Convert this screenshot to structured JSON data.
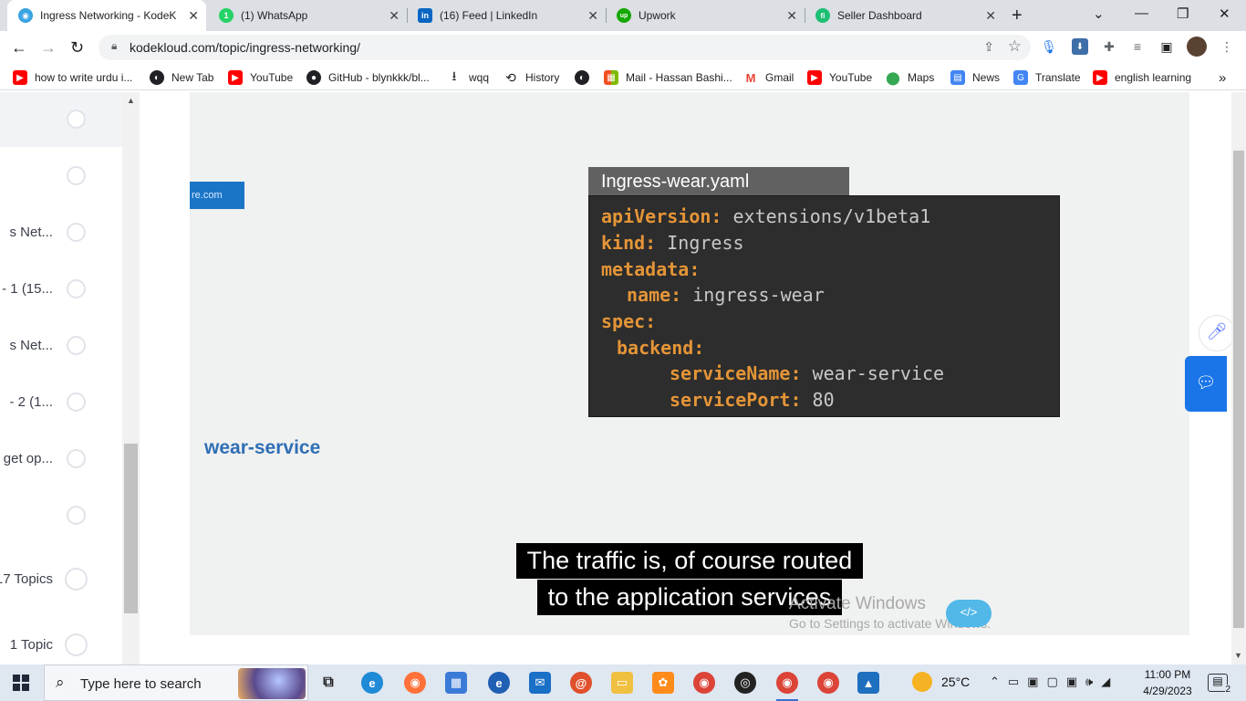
{
  "browser": {
    "tabs": [
      {
        "title": "Ingress Networking - KodeKl",
        "favicon_color": "#3aa3e3",
        "favicon_glyph": "◉",
        "active": true
      },
      {
        "title": "(1) WhatsApp",
        "favicon_color": "#25d366",
        "favicon_glyph": "1",
        "active": false
      },
      {
        "title": "(16) Feed | LinkedIn",
        "favicon_color": "#0a66c2",
        "favicon_glyph": "in",
        "active": false
      },
      {
        "title": "Upwork",
        "favicon_color": "#14a800",
        "favicon_glyph": "up",
        "active": false
      },
      {
        "title": "Seller Dashboard",
        "favicon_color": "#1dbf73",
        "favicon_glyph": "fi",
        "active": false
      }
    ],
    "url": "kodekloud.com/topic/ingress-networking/",
    "bookmarks": [
      {
        "label": "how to write urdu i...",
        "icon": "youtube-icon",
        "color": "#ff0000"
      },
      {
        "label": "New Tab",
        "icon": "globe-icon",
        "color": "#202124"
      },
      {
        "label": "YouTube",
        "icon": "youtube-icon",
        "color": "#ff0000"
      },
      {
        "label": "GitHub - blynkkk/bl...",
        "icon": "github-icon",
        "color": "#202124"
      },
      {
        "label": "wqq",
        "icon": "download-icon",
        "color": "#202124"
      },
      {
        "label": "History",
        "icon": "history-icon",
        "color": "#202124"
      },
      {
        "label": "",
        "icon": "globe-icon",
        "color": "#202124"
      },
      {
        "label": "Mail - Hassan Bashi...",
        "icon": "microsoft-icon",
        "color": "#f25022"
      },
      {
        "label": "Gmail",
        "icon": "gmail-icon",
        "color": "#ea4335"
      },
      {
        "label": "YouTube",
        "icon": "youtube-icon",
        "color": "#ff0000"
      },
      {
        "label": "Maps",
        "icon": "maps-icon",
        "color": "#34a853"
      },
      {
        "label": "News",
        "icon": "news-icon",
        "color": "#4285f4"
      },
      {
        "label": "Translate",
        "icon": "translate-icon",
        "color": "#4285f4"
      },
      {
        "label": "english learning",
        "icon": "youtube-icon",
        "color": "#ff0000"
      }
    ],
    "more_bookmarks": "»"
  },
  "sidebar": {
    "items": [
      {
        "label": ""
      },
      {
        "label": "s Net..."
      },
      {
        "label": "- 1 (15..."
      },
      {
        "label": "s Net..."
      },
      {
        "label": "- 2 (1..."
      },
      {
        "label": "get op..."
      },
      {
        "label": ""
      },
      {
        "label": "17 Topics"
      },
      {
        "label": "1 Topic"
      }
    ]
  },
  "video": {
    "domain_tag": "re.com",
    "service_label": "wear-service",
    "yaml_file": "Ingress-wear.yaml",
    "yaml_lines": [
      {
        "key": "apiVersion:",
        "value": "extensions/v1beta1"
      },
      {
        "key": "kind:",
        "value": "Ingress"
      },
      {
        "key": "metadata:",
        "value": ""
      },
      {
        "key": "name:",
        "value": "ingress-wear"
      },
      {
        "key": "spec:",
        "value": ""
      },
      {
        "key": "backend:",
        "value": ""
      },
      {
        "key": "serviceName:",
        "value": "wear-service"
      },
      {
        "key": "servicePort:",
        "value": "80"
      }
    ],
    "caption_lines": [
      "The traffic is, of course routed",
      "to the application services"
    ]
  },
  "watermark": {
    "line1": "Activate Windows",
    "line2": "Go to Settings to activate Windows."
  },
  "taskbar": {
    "search_placeholder": "Type here to search",
    "temperature": "25°C",
    "time": "11:00 PM",
    "date": "4/29/2023",
    "notifications": "2",
    "apps": [
      {
        "name": "task-view-icon",
        "color": "#2c3e50"
      },
      {
        "name": "edge-icon",
        "color": "#1f8ad6"
      },
      {
        "name": "firefox-icon",
        "color": "#ff7139"
      },
      {
        "name": "store-icon",
        "color": "#3b7bd8"
      },
      {
        "name": "edge-dev-icon",
        "color": "#1f5fb4"
      },
      {
        "name": "mail-icon",
        "color": "#1a6fc7"
      },
      {
        "name": "snail-icon",
        "color": "#e0502c"
      },
      {
        "name": "file-explorer-icon",
        "color": "#f0c040"
      },
      {
        "name": "settings-app-icon",
        "color": "#ff8c1a"
      },
      {
        "name": "chrome-icon",
        "color": "#db4437"
      },
      {
        "name": "obs-icon",
        "color": "#222222"
      },
      {
        "name": "chrome-profile-icon",
        "color": "#db4437"
      },
      {
        "name": "chrome-profile2-icon",
        "color": "#db4437"
      },
      {
        "name": "photos-icon",
        "color": "#1f6fbf"
      }
    ]
  }
}
